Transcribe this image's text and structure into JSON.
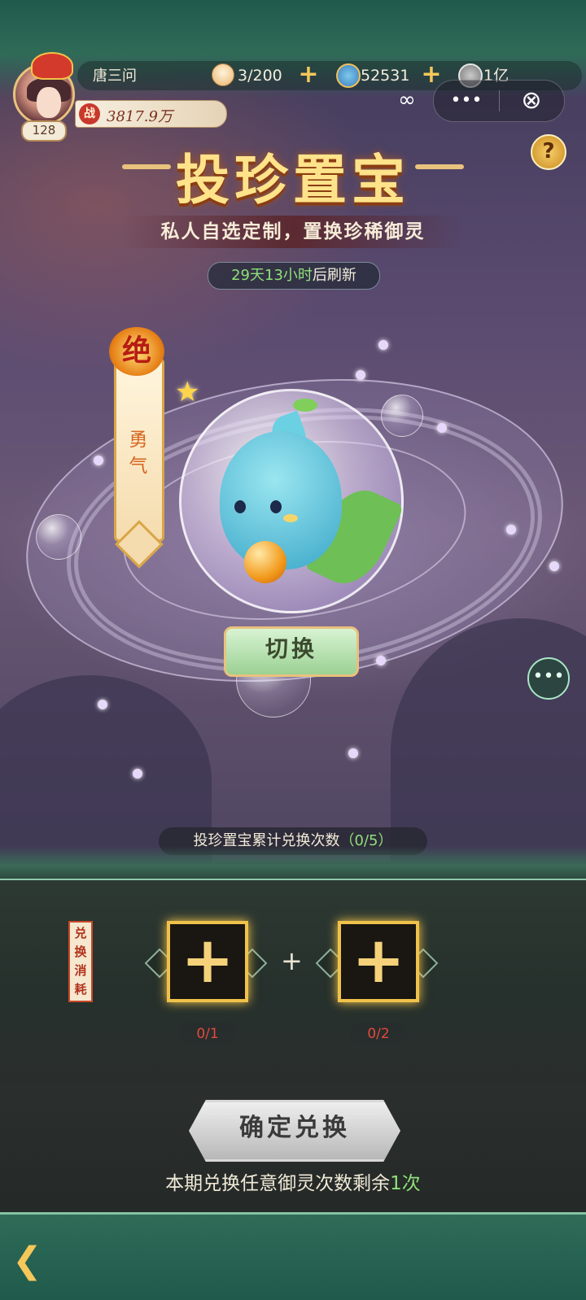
{
  "player": {
    "name": "唐三问",
    "level": "128",
    "power_label": "战",
    "power": "3817.9万"
  },
  "resources": {
    "stamina": "3/200",
    "currency": "52531",
    "cash": "1亿"
  },
  "capsule": {
    "more": "•••",
    "close": "⊗"
  },
  "help": "?",
  "title": "投珍置宝",
  "subtitle": "私人自选定制，置换珍稀御灵",
  "refresh": {
    "time": "29天13小时",
    "suffix": "后刷新"
  },
  "pet": {
    "rarity": "绝",
    "trait": "勇气"
  },
  "switch_label": "切换",
  "exchange_count": {
    "label": "投珍置宝累计兑换次数",
    "value": "（0/5）"
  },
  "cost": {
    "tag": "兑换消耗",
    "slots": [
      {
        "count": "0/1"
      },
      {
        "count": "0/2"
      }
    ],
    "separator": "+"
  },
  "confirm_label": "确定兑换",
  "remaining": {
    "prefix": "本期兑换任意御灵次数剩余",
    "count": "1次"
  }
}
